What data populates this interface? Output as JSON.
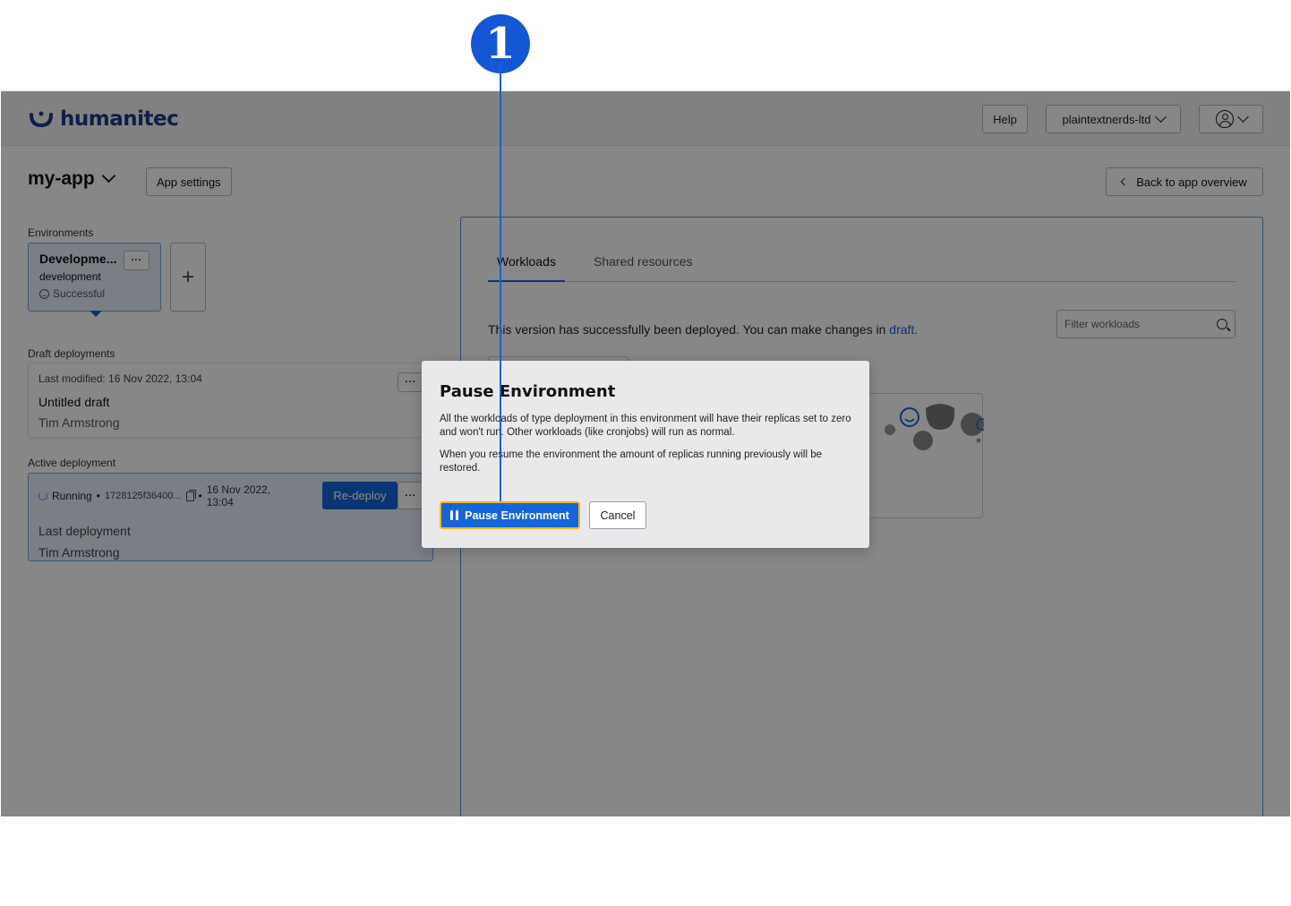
{
  "annotation": {
    "badge_number": "1"
  },
  "header": {
    "logo_text": "humanitec",
    "help_label": "Help",
    "org_label": "plaintextnerds-ltd"
  },
  "app": {
    "name": "my-app",
    "settings_label": "App settings",
    "back_label": "Back to app overview"
  },
  "environments": {
    "section_label": "Environments",
    "items": [
      {
        "title": "Developme...",
        "id": "development",
        "status": "Successful"
      }
    ],
    "add_label": "+"
  },
  "drafts": {
    "section_label": "Draft deployments",
    "items": [
      {
        "modified": "Last modified: 16 Nov 2022, 13:04",
        "title": "Untitled draft",
        "author": "Tim Armstrong"
      }
    ]
  },
  "active": {
    "section_label": "Active deployment",
    "status": "Running",
    "hash": "1728125f36400...",
    "date": "16 Nov 2022, 13:04",
    "redeploy_label": "Re-deploy",
    "line1": "Last deployment",
    "line2": "Tim Armstrong"
  },
  "main": {
    "tabs": [
      "Workloads",
      "Shared resources"
    ],
    "info_text": "This version has successfully been deployed. You can make changes in ",
    "info_link": "draft.",
    "filter_placeholder": "Filter workloads"
  },
  "dialog": {
    "title": "Pause Environment",
    "paragraph1": "All the workloads of type deployment in this environment will have their replicas set to zero and won't run. Other workloads (like cronjobs) will run as normal.",
    "paragraph2": "When you resume the environment the amount of replicas running previously will be restored.",
    "confirm_label": "Pause Environment",
    "cancel_label": "Cancel"
  },
  "colors": {
    "accent": "#1565d8",
    "focus_ring": "#f2b618",
    "annotation": "#1457d4"
  }
}
